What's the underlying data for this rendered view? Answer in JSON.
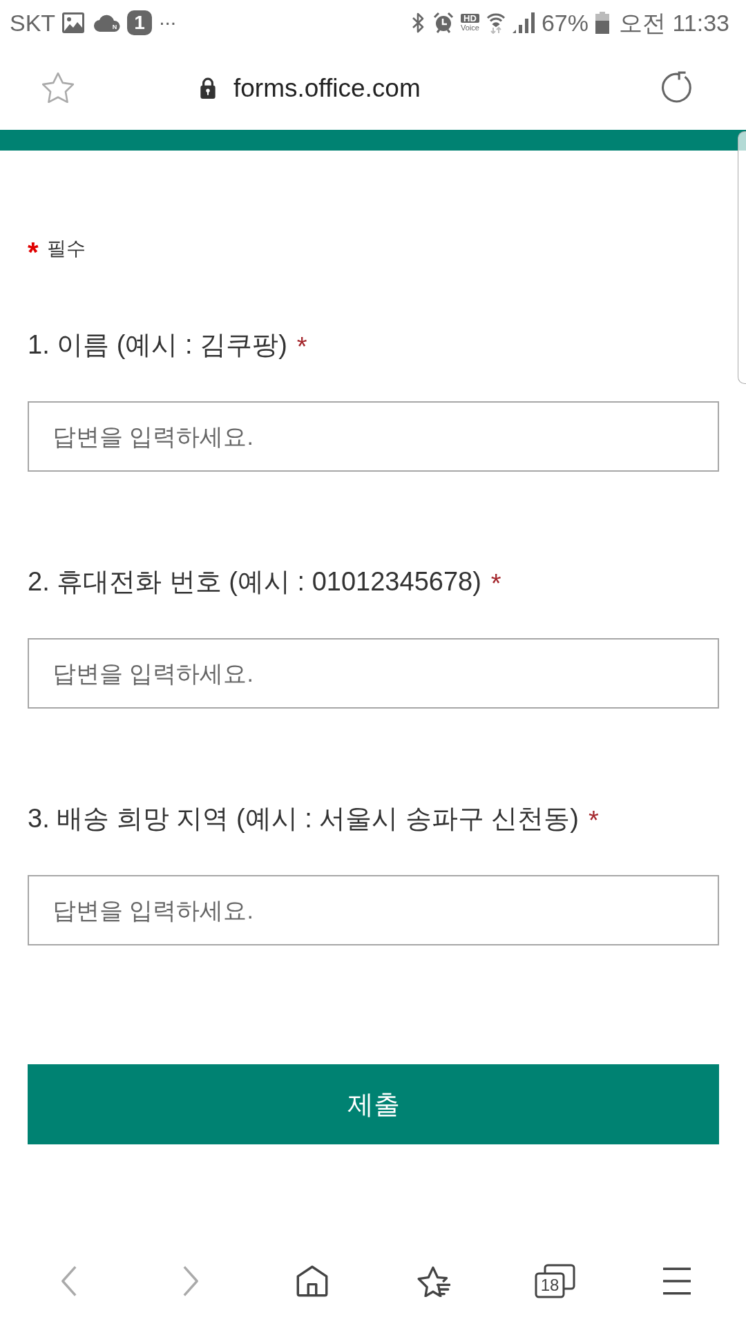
{
  "status_bar": {
    "carrier": "SKT",
    "cloud_badge": "N",
    "app_badge": "1",
    "overflow": "...",
    "hd_voice": {
      "badge": "HD",
      "caption": "Voice"
    },
    "battery": "67%",
    "time": "오전 11:33"
  },
  "address_bar": {
    "bookmarked": false,
    "url": "forms.office.com"
  },
  "form": {
    "required_note": {
      "mark": "*",
      "label": "필수"
    },
    "questions": [
      {
        "label": "1. 이름 (예시 : 김쿠팡)",
        "required_mark": "*",
        "placeholder": "답변을 입력하세요."
      },
      {
        "label": "2. 휴대전화 번호 (예시 : 01012345678)",
        "required_mark": "*",
        "placeholder": "답변을 입력하세요."
      },
      {
        "label": "3. 배송 희망 지역 (예시 : 서울시 송파구 신천동)",
        "required_mark": "*",
        "placeholder": "답변을 입력하세요."
      }
    ],
    "submit": {
      "label": "제출"
    }
  },
  "toolbar": {
    "items": [
      {
        "kind": "back",
        "disabled": true
      },
      {
        "kind": "forward",
        "disabled": true
      },
      {
        "kind": "home",
        "disabled": false
      },
      {
        "kind": "bookmarks",
        "disabled": false
      },
      {
        "kind": "tabs",
        "disabled": false,
        "count": "18"
      },
      {
        "kind": "menu",
        "disabled": false
      }
    ]
  }
}
